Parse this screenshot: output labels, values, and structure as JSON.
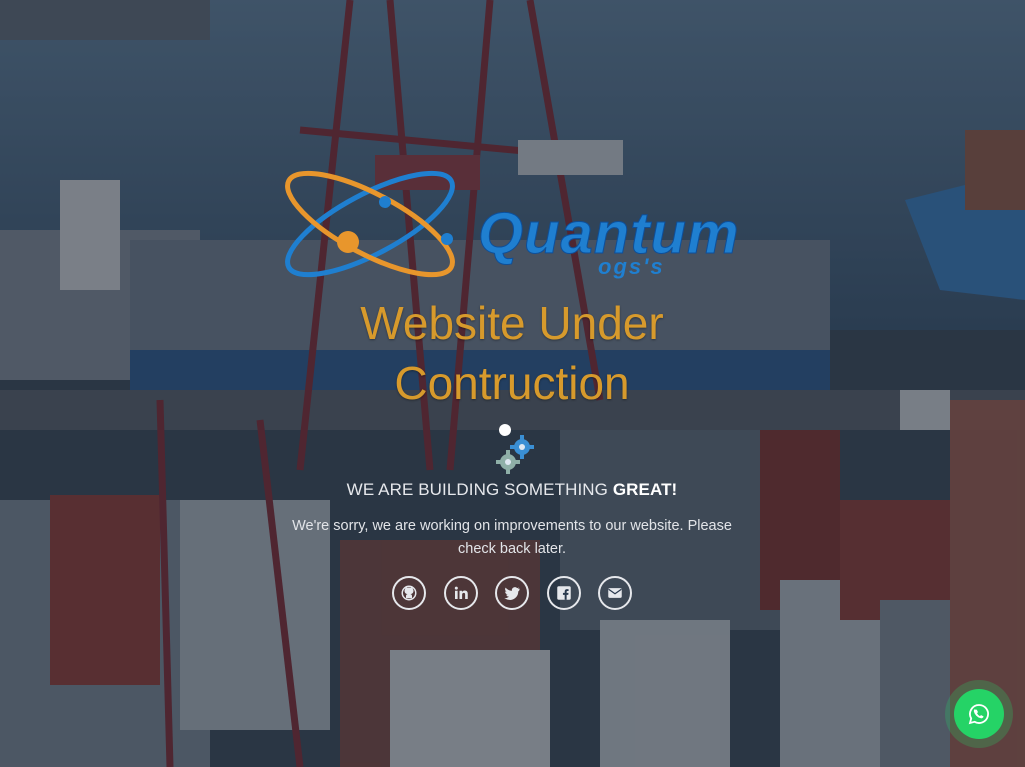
{
  "logo": {
    "word": "Quantum",
    "subword": "ogs's",
    "colors": {
      "blue": "#1f7fd0",
      "orange": "#e8962c"
    }
  },
  "headline": {
    "line1": "Website Under",
    "line2": "Contruction",
    "color": "#d79a2c"
  },
  "tagline": {
    "prefix": "WE ARE BUILDING SOMETHING",
    "emphasis": "GREAT!"
  },
  "message": "We're sorry, we are working on improvements to our website. Please check back later.",
  "socials": [
    {
      "icon": "github-icon"
    },
    {
      "icon": "linkedin-icon"
    },
    {
      "icon": "twitter-icon"
    },
    {
      "icon": "facebook-icon"
    },
    {
      "icon": "envelope-icon"
    }
  ],
  "whatsapp": {
    "icon": "whatsapp-icon",
    "color": "#25d366"
  },
  "background": {
    "subject": "container port",
    "tone": "#2a3a4e"
  }
}
